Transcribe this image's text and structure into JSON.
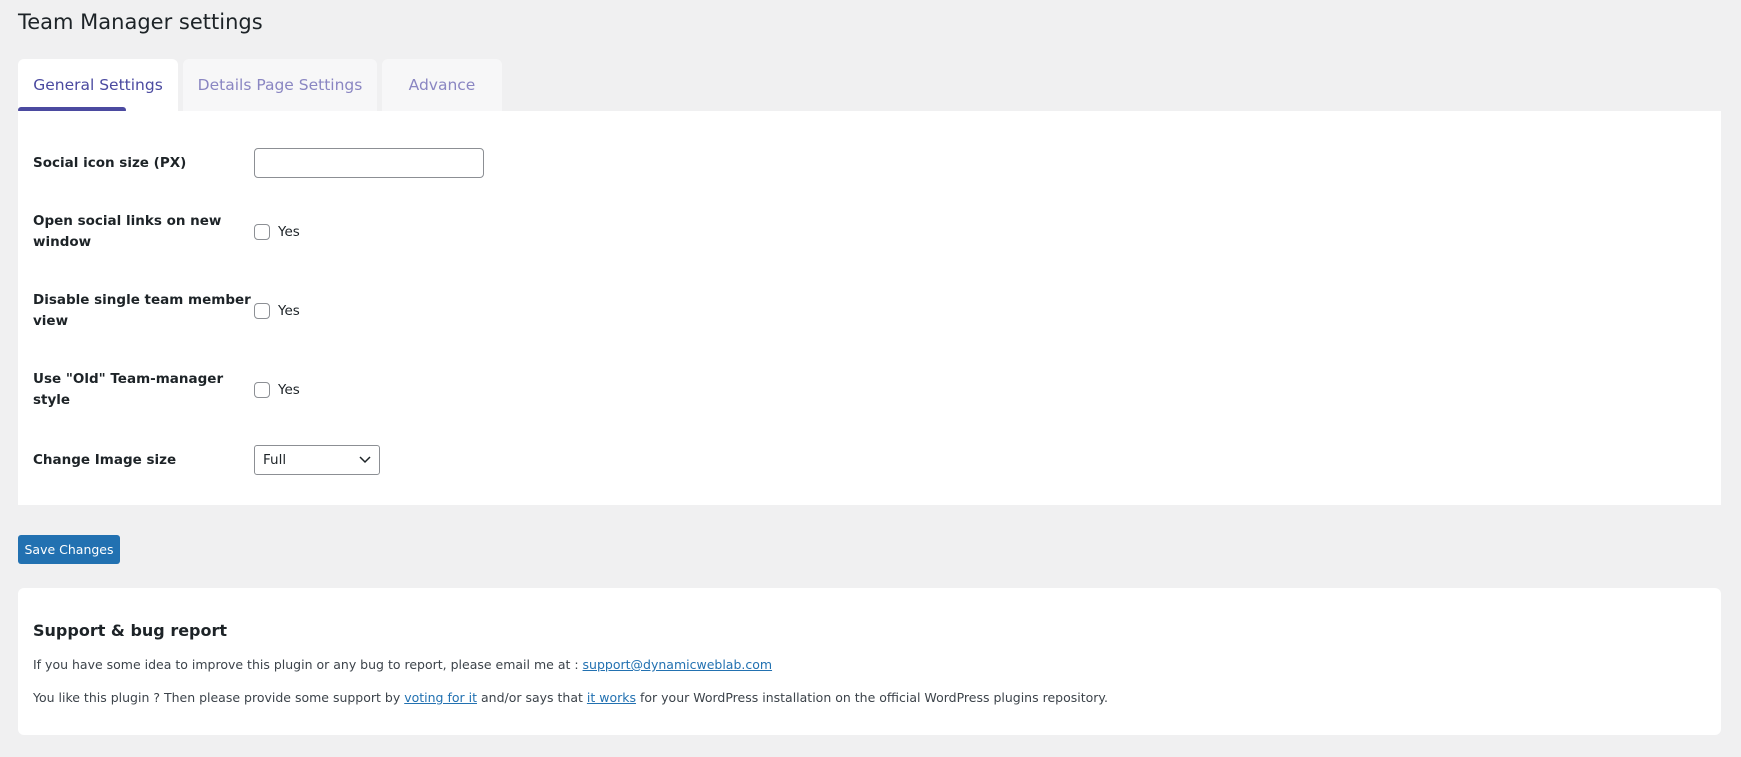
{
  "page_title": "Team Manager settings",
  "tabs": [
    {
      "label": "General Settings",
      "active": true
    },
    {
      "label": "Details Page Settings",
      "active": false
    },
    {
      "label": "Advance",
      "active": false
    }
  ],
  "settings": {
    "social_icon_size": {
      "label": "Social icon size (PX)",
      "value": ""
    },
    "open_new_window": {
      "label": "Open social links on new window",
      "option": "Yes",
      "checked": false
    },
    "disable_single": {
      "label": "Disable single team member view",
      "option": "Yes",
      "checked": false
    },
    "old_style": {
      "label": "Use \"Old\" Team-manager style",
      "option": "Yes",
      "checked": false
    },
    "image_size": {
      "label": "Change Image size",
      "value": "Full"
    }
  },
  "save_label": "Save Changes",
  "support": {
    "heading": "Support & bug report",
    "line1_text": "If you have some idea to improve this plugin or any bug to report, please email me at : ",
    "email": "support@dynamicweblab.com",
    "line2_a": "You like this plugin ? Then please provide some support by ",
    "link1": "voting for it",
    "line2_b": " and/or says that ",
    "link2": "it works",
    "line2_c": " for your WordPress installation on the official WordPress plugins repository."
  },
  "colors": {
    "accent": "#4b4aa0",
    "button": "#2271b1",
    "background": "#f0f0f1"
  }
}
